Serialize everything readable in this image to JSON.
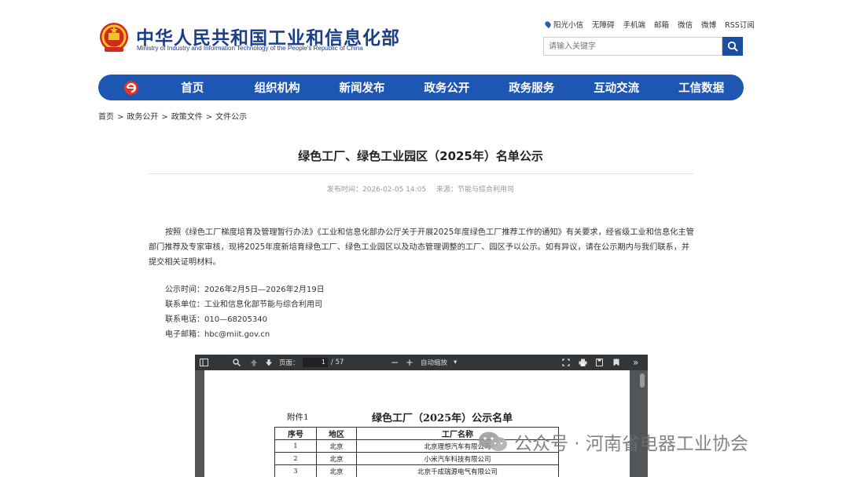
{
  "header": {
    "logo_cn": "中华人民共和国工业和信息化部",
    "logo_en": "Ministry of Industry and Information Technology of the People's Republic of China",
    "top_links": [
      "阳光小信",
      "无障碍",
      "手机端",
      "邮箱",
      "微信",
      "微博",
      "RSS订阅"
    ],
    "search_placeholder": "请输入关键字"
  },
  "nav": {
    "items": [
      "首页",
      "组织机构",
      "新闻发布",
      "政务公开",
      "政务服务",
      "互动交流",
      "工信数据"
    ]
  },
  "breadcrumb": [
    "首页",
    "政务公开",
    "政策文件",
    "文件公示"
  ],
  "article": {
    "title": "绿色工厂、绿色工业园区（2025年）名单公示",
    "publish_time": "发布时间：2026-02-05 14:05",
    "source": "来源：节能与综合利用司",
    "paragraph": "按照《绿色工厂梯度培育及管理暂行办法》《工业和信息化部办公厅关于开展2025年度绿色工厂推荐工作的通知》有关要求，经省级工业和信息化主管部门推荐及专家审核，现将2025年度新培育绿色工厂、绿色工业园区以及动态管理调整的工厂、园区予以公示。如有异议，请在公示期内与我们联系，并提交相关证明材料。",
    "info": [
      "公示时间：2026年2月5日—2026年2月19日",
      "联系单位：工业和信息化部节能与综合利用司",
      "联系电话：010—68205340",
      "电子邮箱：hbc@miit.gov.cn"
    ]
  },
  "pdf_viewer": {
    "page_label": "页面：",
    "page_current": "1",
    "page_total": "/ 57",
    "zoom_label": "自动缩放",
    "attachment": "附件1",
    "doc_title": "绿色工厂（2025年）公示名单",
    "table_headers": [
      "序号",
      "地区",
      "工厂名称"
    ],
    "rows": [
      [
        "1",
        "北京",
        "北京理想汽车有限公司"
      ],
      [
        "2",
        "北京",
        "小米汽车科技有限公司"
      ],
      [
        "3",
        "北京",
        "北京千成瑞源电气有限公司"
      ]
    ]
  },
  "watermark": "公众号 · 河南省电器工业协会",
  "colors": {
    "brand_blue": "#1e56b4",
    "logo_red": "#d7281d"
  }
}
